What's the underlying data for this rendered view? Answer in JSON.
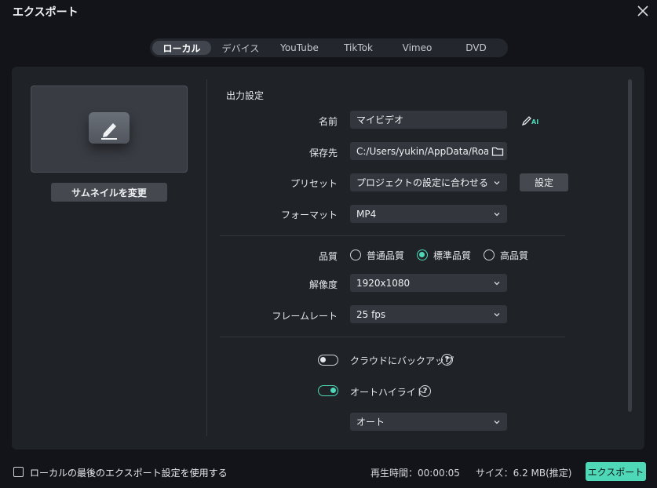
{
  "window": {
    "title": "エクスポート",
    "close_icon": "close-icon"
  },
  "tabs": [
    {
      "label": "ローカル",
      "active": true
    },
    {
      "label": "デバイス",
      "active": false
    },
    {
      "label": "YouTube",
      "active": false
    },
    {
      "label": "TikTok",
      "active": false
    },
    {
      "label": "Vimeo",
      "active": false
    },
    {
      "label": "DVD",
      "active": false
    }
  ],
  "thumbnail": {
    "icon": "edit-icon",
    "change_label": "サムネイルを変更"
  },
  "settings": {
    "section_title": "出力設定",
    "name": {
      "label": "名前",
      "value": "マイビデオ",
      "ai_icon": "ai-rename-icon"
    },
    "save_to": {
      "label": "保存先",
      "value": "C:/Users/yukin/AppData/Roan",
      "icon": "folder-icon"
    },
    "preset": {
      "label": "プリセット",
      "value": "プロジェクトの設定に合わせる",
      "settings_button": "設定"
    },
    "format": {
      "label": "フォーマット",
      "value": "MP4"
    },
    "quality": {
      "label": "品質",
      "options": [
        {
          "label": "普通品質",
          "checked": false
        },
        {
          "label": "標準品質",
          "checked": true
        },
        {
          "label": "高品質",
          "checked": false
        }
      ]
    },
    "resolution": {
      "label": "解像度",
      "value": "1920x1080"
    },
    "framerate": {
      "label": "フレームレート",
      "value": "25 fps"
    },
    "cloud_backup": {
      "label": "クラウドにバックアップ",
      "enabled": false
    },
    "auto_highlight": {
      "label": "オートハイライト",
      "enabled": true,
      "dropdown_value": "オート"
    }
  },
  "footer": {
    "use_last_settings_label": "ローカルの最後のエクスポート設定を使用する",
    "duration": "再生時間：00:00:05",
    "size": "サイズ：6.2 MB(推定)",
    "export_button": "エクスポート"
  },
  "colors": {
    "accent": "#4fd8b7",
    "background": "#121419",
    "panel": "#1f2227"
  }
}
